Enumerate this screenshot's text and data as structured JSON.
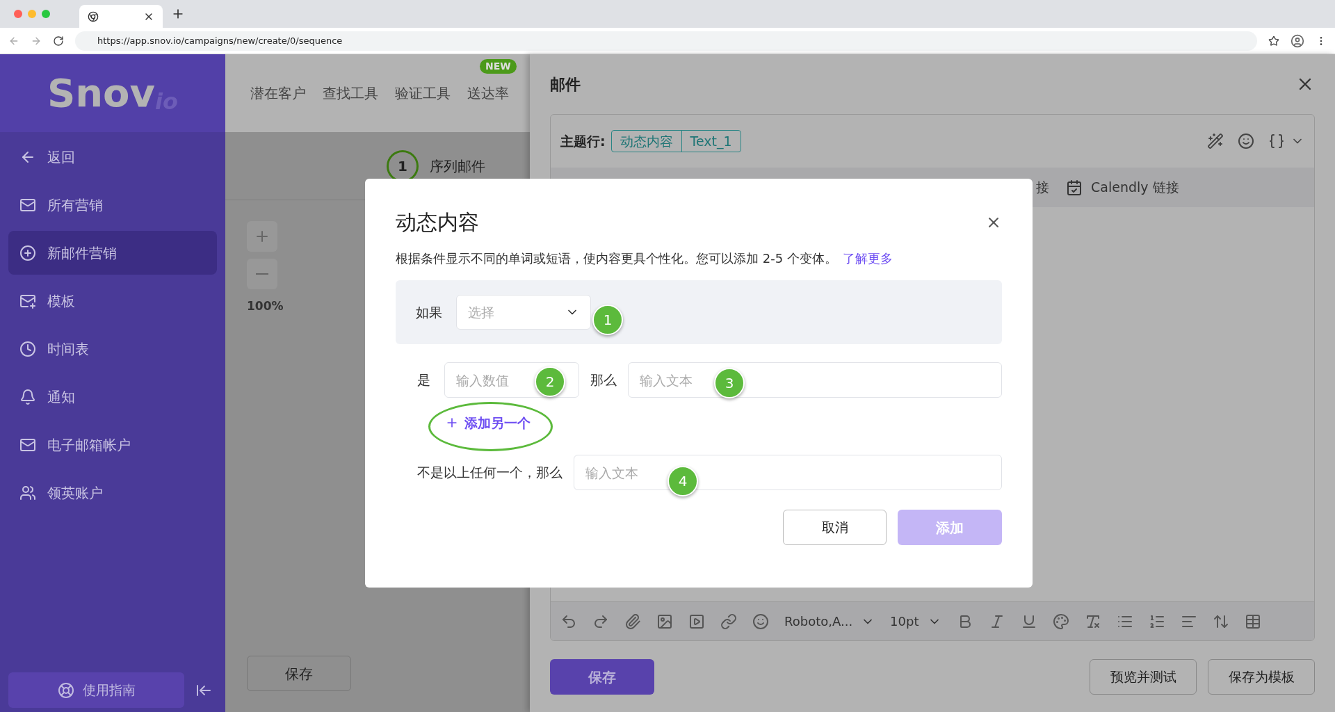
{
  "browser": {
    "url": "https://app.snov.io/campaigns/new/create/0/sequence"
  },
  "sidebar": {
    "logo": {
      "main": "Snov",
      "suffix": "io"
    },
    "items": [
      {
        "label": "返回",
        "selected": false
      },
      {
        "label": "所有营销",
        "selected": false
      },
      {
        "label": "新邮件营销",
        "selected": true
      },
      {
        "label": "模板",
        "selected": false
      },
      {
        "label": "时间表",
        "selected": false
      },
      {
        "label": "通知",
        "selected": false
      },
      {
        "label": "电子邮箱帐户",
        "selected": false
      },
      {
        "label": "领英账户",
        "selected": false
      }
    ],
    "guide_button": "使用指南"
  },
  "top_nav": {
    "items": [
      {
        "label": "潜在客户"
      },
      {
        "label": "查找工具"
      },
      {
        "label": "验证工具"
      },
      {
        "label": "送达率",
        "badge": "NEW"
      }
    ]
  },
  "steps": [
    {
      "number": "1",
      "label": "序列邮件"
    }
  ],
  "canvas": {
    "zoom": "100%",
    "save_button": "保存"
  },
  "email_panel": {
    "title": "邮件",
    "subject_label": "主题行:",
    "subject_tags": [
      "动态内容",
      "Text_1"
    ],
    "links": [
      "接",
      "Calendly 链接"
    ],
    "font": "Roboto,A...",
    "font_size": "10pt",
    "save_button": "保存",
    "preview_button": "预览并测试",
    "template_button": "保存为模板"
  },
  "modal": {
    "title": "动态内容",
    "description": "根据条件显示不同的单词或短语，使内容更具个性化。您可以添加 2-5 个变体。",
    "learn_more": "了解更多",
    "if_label": "如果",
    "select_placeholder": "选择",
    "is_label": "是",
    "value_placeholder": "输入数值",
    "then_label": "那么",
    "then_placeholder": "输入文本",
    "add_another": "添加另一个",
    "else_label": "不是以上任何一个，那么",
    "else_placeholder": "输入文本",
    "cancel_button": "取消",
    "add_button": {
      "label": "添加",
      "disabled": true
    }
  },
  "markers": [
    "1",
    "2",
    "3",
    "4"
  ]
}
